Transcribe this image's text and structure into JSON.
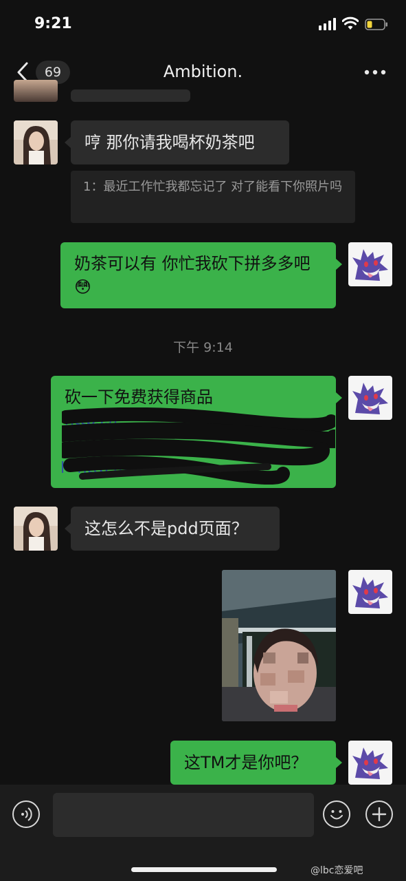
{
  "status_bar": {
    "time": "9:21"
  },
  "nav": {
    "unread_count": "69",
    "title": "Ambition."
  },
  "messages": [
    {
      "from": "other",
      "text": "哼 那你请我喝杯奶茶吧",
      "quote": "1：最近工作忙我都忘记了 对了能看下你照片吗"
    },
    {
      "from": "me",
      "text": "奶茶可以有 你忙我砍下拼多多吧😳"
    },
    {
      "type": "timestamp",
      "text": "下午 9:14"
    },
    {
      "from": "me",
      "text": "砍一下免费获得商品",
      "link_fragment_top": "https://...",
      "link_fragment_bottom": "l=http://qq.com"
    },
    {
      "from": "other",
      "text": "这怎么不是pdd页面？"
    },
    {
      "from": "me",
      "type": "image"
    },
    {
      "from": "me",
      "text": "这TM才是你吧？"
    }
  ],
  "watermark": "@lbc恋爱吧",
  "icons": {
    "back": "chevron-left-icon",
    "more": "more-dots-icon",
    "voice": "voice-icon",
    "emoji": "emoji-icon",
    "add": "plus-icon"
  },
  "colors": {
    "background": "#111111",
    "bubble_green": "#3bb24a",
    "bubble_gray": "#2c2c2c"
  }
}
